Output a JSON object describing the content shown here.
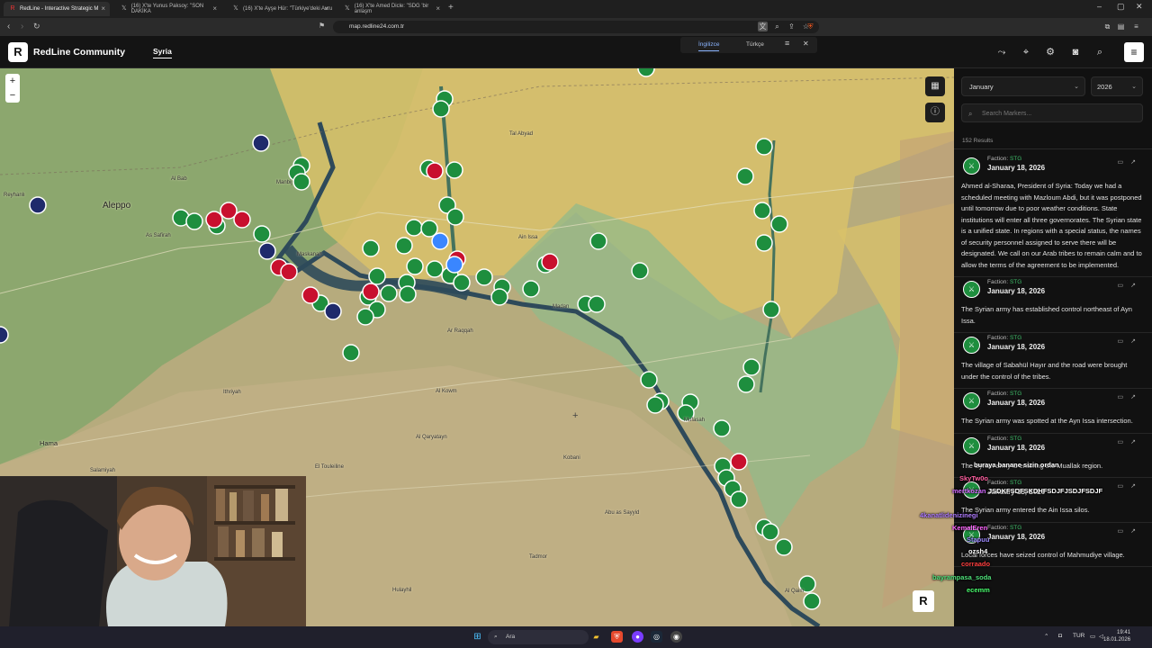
{
  "browser": {
    "tabs": [
      {
        "label": "RedLine - Interactive Strategic M",
        "icon": "redline-favicon"
      },
      {
        "label": "(16) X'te Yunus Paksoy: \"SON DAKİKA",
        "icon": "x-icon"
      },
      {
        "label": "(16) X'te Ayşe Hür: \"Türkiye'deki Avru",
        "icon": "x-icon"
      },
      {
        "label": "(16) X'te Amed Dicle: \"SDG 'bir anlaşm",
        "icon": "x-icon"
      }
    ],
    "url": "map.redline24.com.tr"
  },
  "header": {
    "brand": "RedLine Community",
    "logo_letter": "R",
    "country": "Syria",
    "languages": [
      "İngilizce",
      "Türkçe"
    ],
    "selected_language": "İngilizce"
  },
  "sidebar": {
    "month": "January",
    "year": "2026",
    "search_placeholder": "Search Markers...",
    "results": "152 Results",
    "entries": [
      {
        "faction_label": "Faction:",
        "faction": "STG",
        "date": "January 18, 2026",
        "text": "Ahmed al-Sharaa, President of Syria: Today we had a scheduled meeting with Mazloum Abdi, but it was postponed until tomorrow due to poor weather conditions. State institutions will enter all three governorates. The Syrian state is a unified state. In regions with a special status, the names of security personnel assigned to serve there will be designated. We call on our Arab tribes to remain calm and to allow the terms of the agreement to be implemented."
      },
      {
        "faction_label": "Faction:",
        "faction": "STG",
        "date": "January 18, 2026",
        "text": "The Syrian army has established control northeast of Ayn Issa."
      },
      {
        "faction_label": "Faction:",
        "faction": "STG",
        "date": "January 18, 2026",
        "text": "The village of Sabahül Hayır and the road were brought under the control of the tribes."
      },
      {
        "faction_label": "Faction:",
        "faction": "STG",
        "date": "January 18, 2026",
        "text": "The Syrian army was spotted at the Ayn Issa intersection."
      },
      {
        "faction_label": "Faction:",
        "faction": "STG",
        "date": "January 18, 2026",
        "text": "The Syrian army is entering the Muallak region."
      },
      {
        "faction_label": "Faction:",
        "faction": "STG",
        "date": "January 18, 2026",
        "text": "The Syrian army entered the Ain Issa silos."
      },
      {
        "faction_label": "Faction:",
        "faction": "STG",
        "date": "January 18, 2026",
        "text": "Local forces have seized control of Mahmudiye village."
      }
    ]
  },
  "chat": [
    {
      "name": "",
      "msg": "buraya banane sizin ordan",
      "color": "#ffffff"
    },
    {
      "name": "SkyTw0o",
      "msg": "",
      "color": "#ff5fa0"
    },
    {
      "name": "mertkozan",
      "msg": "JSDKFSDFSKDHFSDJFJSDJFSDJF",
      "color": "#d36bff"
    },
    {
      "name": "4kanatlidenizinegi",
      "msg": "",
      "color": "#b07cff"
    },
    {
      "name": "KemalEren",
      "msg": "",
      "color": "#ff66ff"
    },
    {
      "name": "Stapuu",
      "msg": "",
      "color": "#9f8bff"
    },
    {
      "name": "ozsh4",
      "msg": "",
      "color": "#ffffff"
    },
    {
      "name": "corraado",
      "msg": "",
      "color": "#ff4040"
    },
    {
      "name": "bayrampasa_soda",
      "msg": "",
      "color": "#4fe07a"
    },
    {
      "name": "ecemm",
      "msg": "",
      "color": "#49ff6e"
    }
  ],
  "map_labels": [
    {
      "text": "Aleppo",
      "size": "big"
    },
    {
      "text": "Hama",
      "size": "mid"
    },
    {
      "text": "Reyhanlı",
      "size": "small"
    },
    {
      "text": "Manbij",
      "size": "small"
    },
    {
      "text": "Al Bab",
      "size": "small"
    },
    {
      "text": "As Safirah",
      "size": "small"
    },
    {
      "text": "Maskanah",
      "size": "small"
    },
    {
      "text": "Kobani",
      "size": "small"
    },
    {
      "text": "Al Qaryatayn",
      "size": "small"
    },
    {
      "text": "Tadmor",
      "size": "small"
    },
    {
      "text": "Ar Raqqah",
      "size": "small"
    },
    {
      "text": "Abu as Sayyid",
      "size": "small"
    },
    {
      "text": "Al Qaim",
      "size": "small"
    },
    {
      "text": "Ain Issa",
      "size": "small"
    },
    {
      "text": "Tal Abyad",
      "size": "small"
    },
    {
      "text": "Mufasah",
      "size": "small"
    },
    {
      "text": "Madan",
      "size": "small"
    },
    {
      "text": "Ithriyah",
      "size": "small"
    },
    {
      "text": "Hulayhil",
      "size": "small"
    },
    {
      "text": "Al Kowm",
      "size": "small"
    },
    {
      "text": "Salamiyah",
      "size": "small"
    },
    {
      "text": "El Touleiline",
      "size": "small"
    }
  ],
  "colors": {
    "control_yellow": "#d9c16a",
    "control_green": "#93b98a",
    "marker_green": "#1e8e3e",
    "marker_red": "#c8102e",
    "marker_navy": "#1f2a6b",
    "marker_blue": "#3a86ff",
    "water": "#2e4a5a"
  },
  "taskbar": {
    "search": "Ara",
    "lang": "TUR",
    "time": "19:41",
    "date": "18.01.2026"
  }
}
